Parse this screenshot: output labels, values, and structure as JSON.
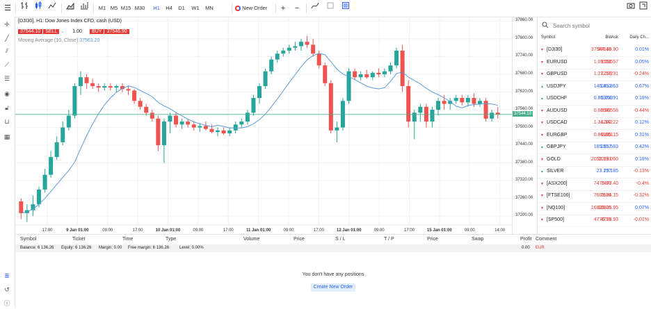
{
  "toolbar": {
    "timeframes": [
      "M1",
      "M5",
      "M15",
      "M30",
      "H1",
      "H4",
      "D1",
      "W1",
      "MN"
    ],
    "active_timeframe": "H1",
    "new_order_label": "New Order"
  },
  "chart": {
    "symbol_title": "[DJI30], H1: Dow Jones Index CFD, cash (USD)",
    "sell_price": "37544.10",
    "sell_label": "SELL",
    "volume": "1.00",
    "buy_label": "BUY",
    "buy_price": "37546.90",
    "indicator_label": "Moving Average (10, Close)",
    "indicator_value": "37563.20",
    "price_ticks": [
      "37860.00",
      "37800.00",
      "37740.00",
      "37680.00",
      "37620.00",
      "37560.00",
      "37500.00",
      "37440.00",
      "37380.00",
      "37320.00",
      "37260.00",
      "37200.00"
    ],
    "last_price_tag": "37544.10",
    "time_ticks": [
      "17:00",
      "9 Jan 01:00",
      "09:00",
      "17:00",
      "10 Jan 01:00",
      "09:00",
      "17:00",
      "11 Jan 01:00",
      "09:00",
      "17:00",
      "12 Jan 01:00",
      "09:00",
      "17:00",
      "15 Jan 01:00",
      "09:00",
      "14:00"
    ],
    "colors": {
      "up": "#26a69a",
      "down": "#ef5350",
      "ma": "#5b9bd5",
      "price_line": "#4caf8f"
    }
  },
  "chart_data": {
    "type": "candlestick",
    "ylim": [
      37170,
      37875
    ],
    "ma_period": 10,
    "candles": [
      [
        37250,
        37260,
        37190,
        37210
      ],
      [
        37210,
        37240,
        37180,
        37220
      ],
      [
        37220,
        37270,
        37200,
        37240
      ],
      [
        37240,
        37300,
        37230,
        37290
      ],
      [
        37290,
        37360,
        37280,
        37340
      ],
      [
        37340,
        37420,
        37330,
        37400
      ],
      [
        37400,
        37470,
        37390,
        37450
      ],
      [
        37450,
        37520,
        37440,
        37500
      ],
      [
        37500,
        37560,
        37490,
        37540
      ],
      [
        37540,
        37650,
        37530,
        37640
      ],
      [
        37640,
        37690,
        37610,
        37670
      ],
      [
        37670,
        37680,
        37630,
        37650
      ],
      [
        37650,
        37665,
        37630,
        37640
      ],
      [
        37640,
        37650,
        37620,
        37635
      ],
      [
        37635,
        37650,
        37625,
        37640
      ],
      [
        37640,
        37650,
        37625,
        37635
      ],
      [
        37635,
        37645,
        37620,
        37640
      ],
      [
        37640,
        37650,
        37620,
        37630
      ],
      [
        37630,
        37640,
        37610,
        37625
      ],
      [
        37625,
        37630,
        37580,
        37590
      ],
      [
        37590,
        37600,
        37560,
        37570
      ],
      [
        37570,
        37580,
        37540,
        37550
      ],
      [
        37550,
        37560,
        37520,
        37530
      ],
      [
        37530,
        37540,
        37420,
        37440
      ],
      [
        37440,
        37530,
        37380,
        37520
      ],
      [
        37520,
        37550,
        37480,
        37540
      ],
      [
        37540,
        37550,
        37500,
        37510
      ],
      [
        37510,
        37530,
        37495,
        37520
      ],
      [
        37520,
        37530,
        37500,
        37510
      ],
      [
        37510,
        37520,
        37490,
        37500
      ],
      [
        37500,
        37515,
        37485,
        37505
      ],
      [
        37505,
        37520,
        37490,
        37495
      ],
      [
        37495,
        37510,
        37480,
        37485
      ],
      [
        37485,
        37500,
        37470,
        37490
      ],
      [
        37490,
        37500,
        37475,
        37480
      ],
      [
        37480,
        37500,
        37470,
        37490
      ],
      [
        37490,
        37520,
        37480,
        37510
      ],
      [
        37510,
        37530,
        37500,
        37520
      ],
      [
        37520,
        37560,
        37510,
        37550
      ],
      [
        37550,
        37610,
        37540,
        37600
      ],
      [
        37600,
        37650,
        37580,
        37640
      ],
      [
        37640,
        37700,
        37630,
        37690
      ],
      [
        37690,
        37740,
        37680,
        37730
      ],
      [
        37730,
        37760,
        37720,
        37750
      ],
      [
        37750,
        37770,
        37740,
        37760
      ],
      [
        37760,
        37780,
        37750,
        37770
      ],
      [
        37770,
        37790,
        37760,
        37775
      ],
      [
        37775,
        37800,
        37760,
        37790
      ],
      [
        37790,
        37810,
        37770,
        37780
      ],
      [
        37780,
        37800,
        37740,
        37750
      ],
      [
        37750,
        37760,
        37700,
        37710
      ],
      [
        37710,
        37720,
        37640,
        37650
      ],
      [
        37650,
        37660,
        37480,
        37490
      ],
      [
        37490,
        37520,
        37450,
        37500
      ],
      [
        37500,
        37600,
        37490,
        37590
      ],
      [
        37590,
        37700,
        37580,
        37690
      ],
      [
        37690,
        37700,
        37660,
        37670
      ],
      [
        37670,
        37690,
        37660,
        37680
      ],
      [
        37680,
        37695,
        37665,
        37670
      ],
      [
        37670,
        37690,
        37660,
        37685
      ],
      [
        37685,
        37700,
        37670,
        37680
      ],
      [
        37680,
        37700,
        37670,
        37690
      ],
      [
        37690,
        37720,
        37680,
        37710
      ],
      [
        37710,
        37770,
        37700,
        37760
      ],
      [
        37760,
        37780,
        37620,
        37640
      ],
      [
        37640,
        37660,
        37500,
        37520
      ],
      [
        37520,
        37560,
        37460,
        37550
      ],
      [
        37550,
        37580,
        37520,
        37570
      ],
      [
        37570,
        37580,
        37500,
        37520
      ],
      [
        37520,
        37570,
        37500,
        37560
      ],
      [
        37560,
        37600,
        37540,
        37590
      ],
      [
        37590,
        37610,
        37560,
        37580
      ],
      [
        37580,
        37600,
        37560,
        37590
      ],
      [
        37590,
        37610,
        37580,
        37600
      ],
      [
        37600,
        37610,
        37575,
        37585
      ],
      [
        37585,
        37610,
        37570,
        37600
      ],
      [
        37600,
        37615,
        37570,
        37580
      ],
      [
        37580,
        37600,
        37570,
        37590
      ],
      [
        37590,
        37600,
        37520,
        37530
      ],
      [
        37530,
        37560,
        37520,
        37550
      ],
      [
        37550,
        37570,
        37530,
        37544
      ]
    ]
  },
  "watchlist": {
    "search_placeholder": "Search symbol",
    "headers": {
      "symbol": "Symbol",
      "bid": "Bid",
      "ask": "Ask",
      "change": "Daily Ch..."
    },
    "rows": [
      {
        "symbol": "[DJI30]",
        "bid": "37544.10",
        "ask": "37546.90",
        "change": "0.01%",
        "dir": "down",
        "chg_dir": "up"
      },
      {
        "symbol": "EURUSD",
        "bid": "1.09551",
        "ask": "1.09557",
        "change": "0.05%",
        "dir": "down",
        "chg_dir": "up"
      },
      {
        "symbol": "GBPUSD",
        "bid": "1.27218",
        "ask": "1.27231",
        "change": "-0.24%",
        "dir": "down",
        "chg_dir": "down"
      },
      {
        "symbol": "USDJPY",
        "bid": "145.852",
        "ask": "145.863",
        "change": "0.67%",
        "dir": "up",
        "chg_dir": "up"
      },
      {
        "symbol": "USDCHF",
        "bid": "0.85374",
        "ask": "0.85391",
        "change": "0.18%",
        "dir": "up",
        "chg_dir": "up"
      },
      {
        "symbol": "AUDUSD",
        "bid": "0.66547",
        "ask": "0.66558",
        "change": "-0.44%",
        "dir": "down",
        "chg_dir": "down"
      },
      {
        "symbol": "USDCAD",
        "bid": "1.34202",
        "ask": "1.34222",
        "change": "0.12%",
        "dir": "down",
        "chg_dir": "up"
      },
      {
        "symbol": "EURGBP",
        "bid": "0.86105",
        "ask": "0.86115",
        "change": "0.31%",
        "dir": "down",
        "chg_dir": "up"
      },
      {
        "symbol": "GBPJPY",
        "bid": "185.557",
        "ask": "185.583",
        "change": "0.42%",
        "dir": "up",
        "chg_dir": "up"
      },
      {
        "symbol": "GOLD",
        "bid": "2052.791",
        "ask": "2053.060",
        "change": "0.18%",
        "dir": "down",
        "chg_dir": "up"
      },
      {
        "symbol": "SILVER",
        "bid": "23.157",
        "ask": "23.185",
        "change": "-0.13%",
        "dir": "up",
        "chg_dir": "down"
      },
      {
        "symbol": "[ASX200]",
        "bid": "7475.60",
        "ask": "7477.40",
        "change": "-0.4%",
        "dir": "down",
        "chg_dir": "down"
      },
      {
        "symbol": "[FTSE100]",
        "bid": "7603.35",
        "ask": "7604.15",
        "change": "-0.32%",
        "dir": "down",
        "chg_dir": "down"
      },
      {
        "symbol": "[NQ100]",
        "bid": "16825.05",
        "ask": "16826.95",
        "change": "0.07%",
        "dir": "down",
        "chg_dir": "up"
      },
      {
        "symbol": "[SP500]",
        "bid": "4776.53",
        "ask": "4776.93",
        "change": "-0.01%",
        "dir": "down",
        "chg_dir": "down"
      }
    ]
  },
  "positions": {
    "headers": [
      "Symbol",
      "Ticket",
      "Time",
      "Type",
      "Volume",
      "Price",
      "S / L",
      "T / P",
      "Price",
      "Swap",
      "Profit",
      "Comment"
    ],
    "balance": "Balance: 6 136.26",
    "equity": "Equity: 6 136.26",
    "margin": "Margin: 0.00",
    "free_margin": "Free margin: 6 136.26",
    "level": "Level: 0.00%",
    "profit_total": "0.00",
    "currency": "EUR",
    "empty_message": "You don't have any positions",
    "create_button": "Create New Order"
  }
}
